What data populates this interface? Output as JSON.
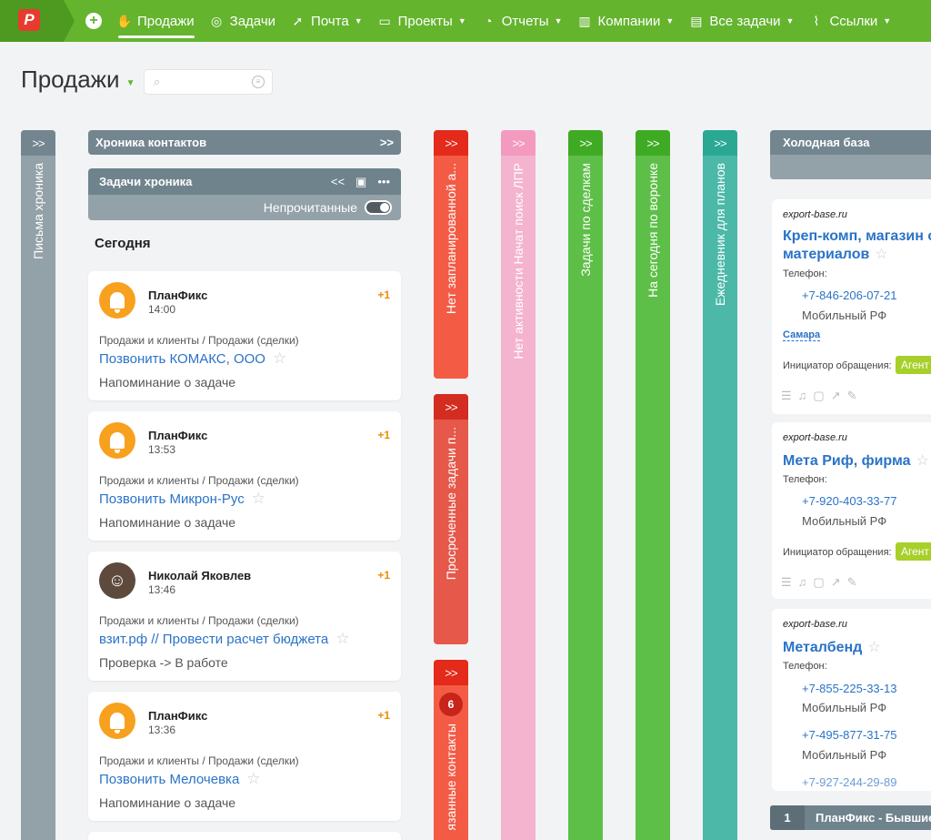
{
  "nav": {
    "items": [
      {
        "label": "Продажи",
        "icon": "handshake-icon",
        "active": true
      },
      {
        "label": "Задачи",
        "icon": "check-circle-icon"
      },
      {
        "label": "Почта",
        "icon": "rocket-icon"
      },
      {
        "label": "Проекты",
        "icon": "briefcase-icon"
      },
      {
        "label": "Отчеты",
        "icon": "pie-chart-icon"
      },
      {
        "label": "Компании",
        "icon": "building-icon"
      },
      {
        "label": "Все задачи",
        "icon": "clipboard-icon"
      },
      {
        "label": "Ссылки",
        "icon": "paperclip-icon"
      }
    ]
  },
  "page": {
    "title": "Продажи"
  },
  "columns": {
    "letters": "Письма хроника",
    "no_planned": "Нет запланированной а...",
    "overdue": "Просроченные задачи п...",
    "linked": "язанные контакты",
    "linked_badge": "6",
    "no_activity": "Нет активности Начат поиск ЛПР",
    "deals": "Задачи по сделкам",
    "today_funnel": "На сегодня по воронке",
    "diary": "Ежедневник для планов"
  },
  "chronicle": {
    "contacts_title": "Хроника контактов",
    "tasks_title": "Задачи хроника",
    "unread_label": "Непрочитанные",
    "today_label": "Сегодня",
    "cards": [
      {
        "author": "ПланФикс",
        "time": "14:00",
        "plus": "+1",
        "path": "Продажи и клиенты / Продажи (сделки)",
        "link": "Позвонить КОМАКС, ООО",
        "status": "Напоминание о задаче"
      },
      {
        "author": "ПланФикс",
        "time": "13:53",
        "plus": "+1",
        "path": "Продажи и клиенты / Продажи (сделки)",
        "link": "Позвонить Микрон-Рус",
        "status": "Напоминание о задаче"
      },
      {
        "author": "Николай Яковлев",
        "time": "13:46",
        "plus": "+1",
        "path": "Продажи и клиенты / Продажи (сделки)",
        "link": "взит.рф // Провести расчет бюджета",
        "status": "Проверка -> В работе"
      },
      {
        "author": "ПланФикс",
        "time": "13:36",
        "plus": "+1",
        "path": "Продажи и клиенты / Продажи (сделки)",
        "link": "Позвонить Мелочевка",
        "status": "Напоминание о задаче"
      }
    ]
  },
  "cold": {
    "title": "Холодная база",
    "cards": [
      {
        "source": "export-base.ru",
        "title1": "Креп-комп, магазин с",
        "title2": "материалов",
        "phone_label": "Телефон:",
        "phone": "+7-846-206-07-21",
        "operator": "Мобильный РФ",
        "city": "Самара",
        "initiator_label": "Инициатор обращения:",
        "tag": "Агент"
      },
      {
        "source": "export-base.ru",
        "title1": "Мета Риф, фирма",
        "phone_label": "Телефон:",
        "phone": "+7-920-403-33-77",
        "operator": "Мобильный РФ",
        "initiator_label": "Инициатор обращения:",
        "tag": "Агент"
      },
      {
        "source": "export-base.ru",
        "title1": "Металбенд",
        "phone_label": "Телефон:",
        "phone": "+7-855-225-33-13",
        "operator": "Мобильный РФ",
        "phone2": "+7-495-877-31-75",
        "operator2": "Мобильный РФ",
        "phone3": "+7-927-244-29-89"
      }
    ],
    "bottom_num": "1",
    "bottom_label": "ПланФикс - Бывшие/"
  },
  "colors": {
    "brand": "#64b42e",
    "red": "#f35b45",
    "pink": "#f4b3ce",
    "green": "#5ebf48",
    "teal": "#4bb8a8"
  }
}
